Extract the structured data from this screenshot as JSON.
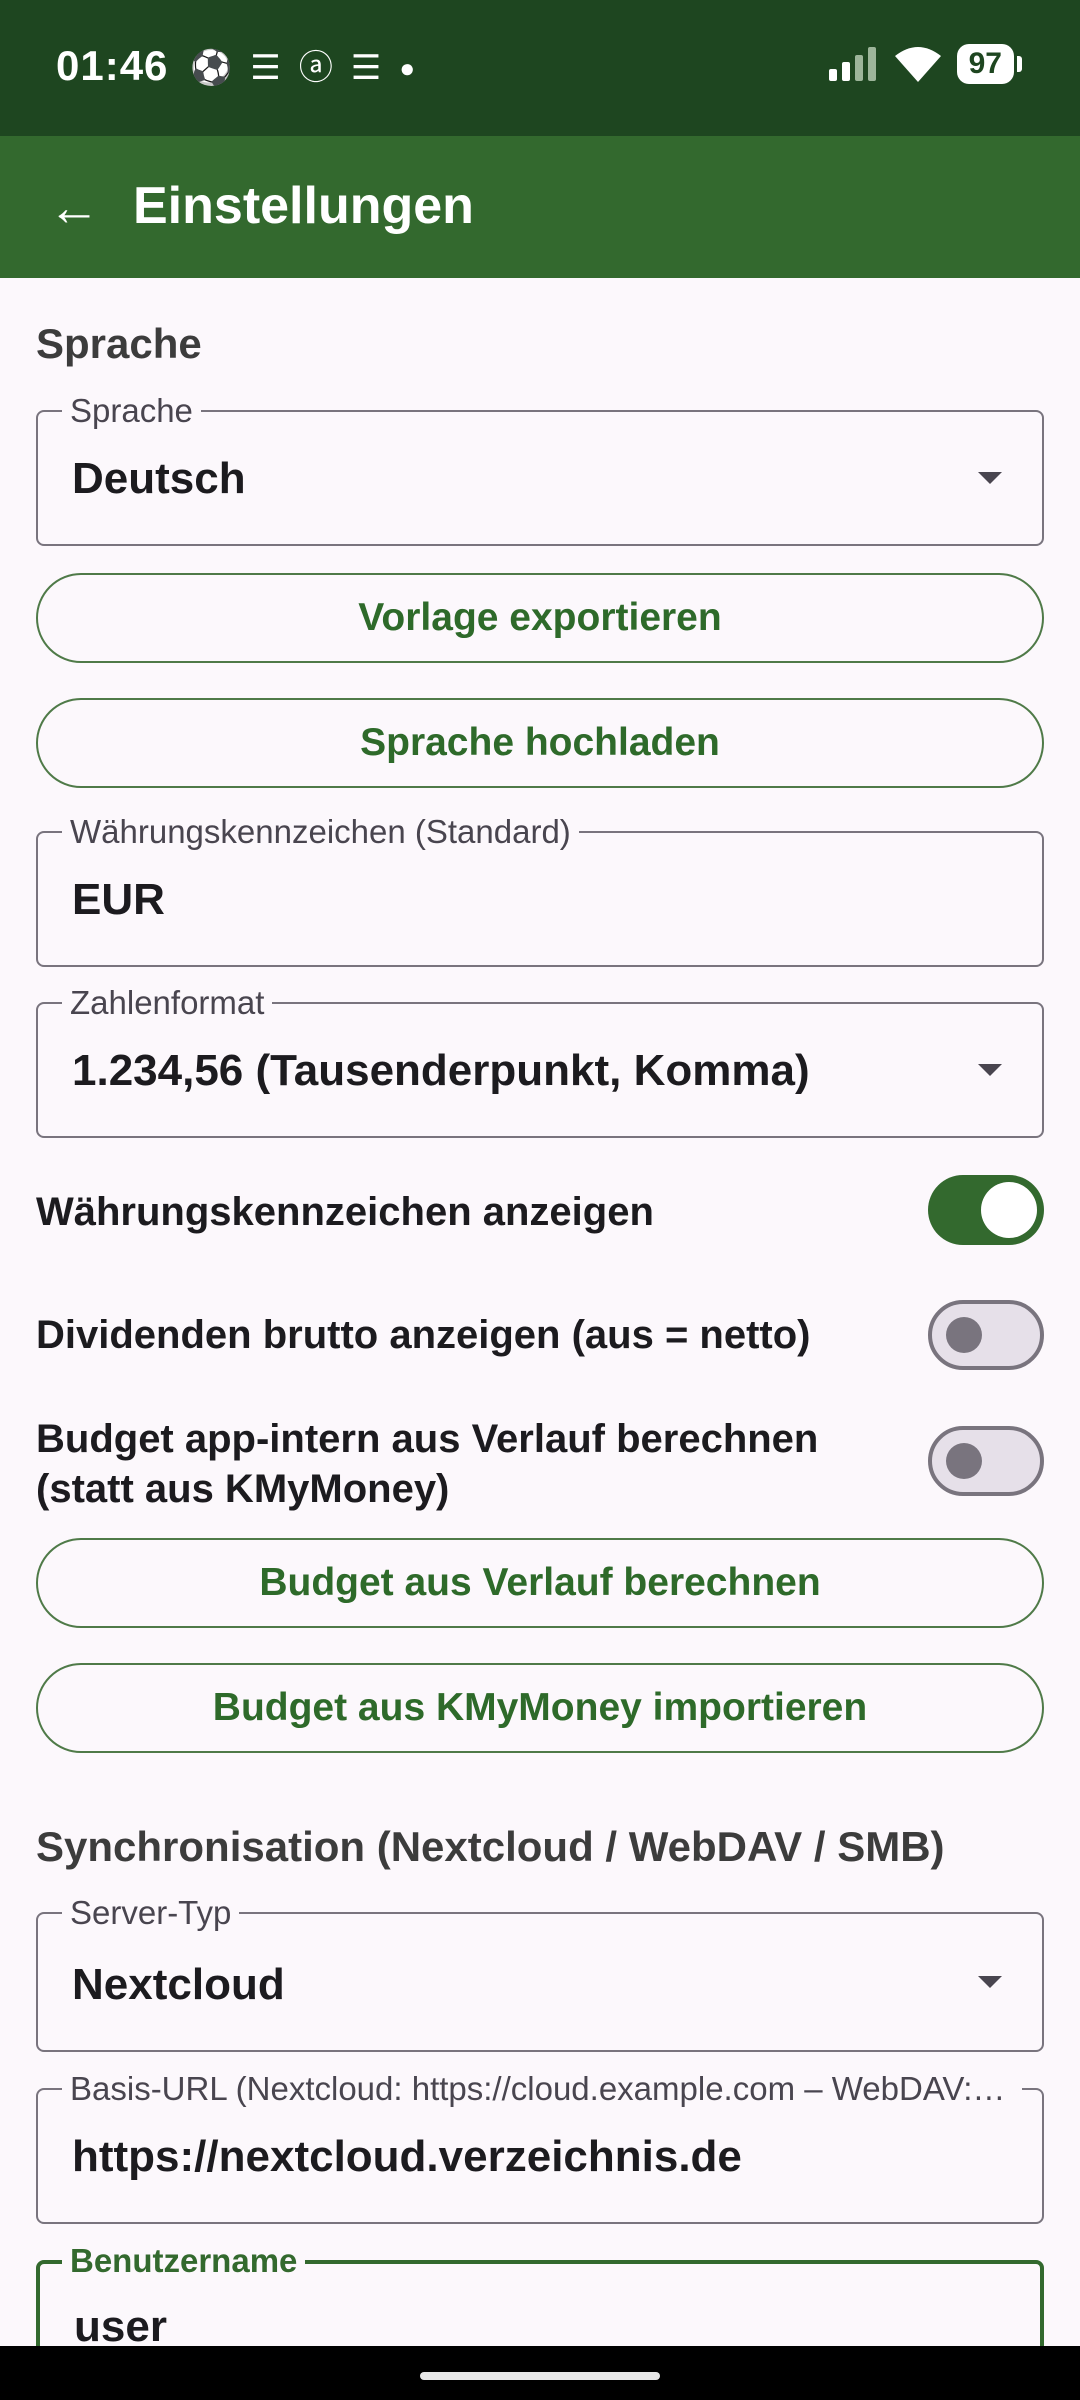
{
  "status_bar": {
    "time": "01:46",
    "notification_icons": [
      "soccer-ball-icon",
      "stack-icon",
      "amazon-icon",
      "stack-icon",
      "dot-icon"
    ],
    "battery": "97"
  },
  "app_bar": {
    "title": "Einstellungen",
    "back_icon": "arrow-left-icon"
  },
  "language_section": {
    "heading": "Sprache",
    "language_field": {
      "label": "Sprache",
      "value": "Deutsch"
    },
    "export_template_button": "Vorlage exportieren",
    "upload_language_button": "Sprache hochladen",
    "currency_field": {
      "label": "Währungskennzeichen (Standard)",
      "value": "EUR"
    },
    "number_format_field": {
      "label": "Zahlenformat",
      "value": "1.234,56 (Tausenderpunkt, Komma)"
    },
    "show_currency_toggle": {
      "label": "Währungskennzeichen anzeigen",
      "on": true
    },
    "gross_dividends_toggle": {
      "label": "Dividenden brutto anzeigen (aus = netto)",
      "on": false
    },
    "budget_internal_toggle": {
      "label": "Budget app-intern aus Verlauf berechnen (statt aus KMyMoney)",
      "on": false
    },
    "budget_from_history_button": "Budget aus Verlauf berechnen",
    "budget_import_button": "Budget aus KMyMoney importieren"
  },
  "sync_section": {
    "heading": "Synchronisation (Nextcloud / WebDAV / SMB)",
    "server_type_field": {
      "label": "Server-Typ",
      "value": "Nextcloud"
    },
    "base_url_field": {
      "label": "Basis-URL (Nextcloud: https://cloud.example.com – WebDAV: …",
      "value": "https://nextcloud.verzeichnis.de"
    },
    "username_field": {
      "label": "Benutzername",
      "value": "user"
    }
  },
  "colors": {
    "status_bar": "#1e4620",
    "app_bar": "#33692e",
    "accent": "#2e6a2a",
    "background": "#fcf8fc"
  }
}
